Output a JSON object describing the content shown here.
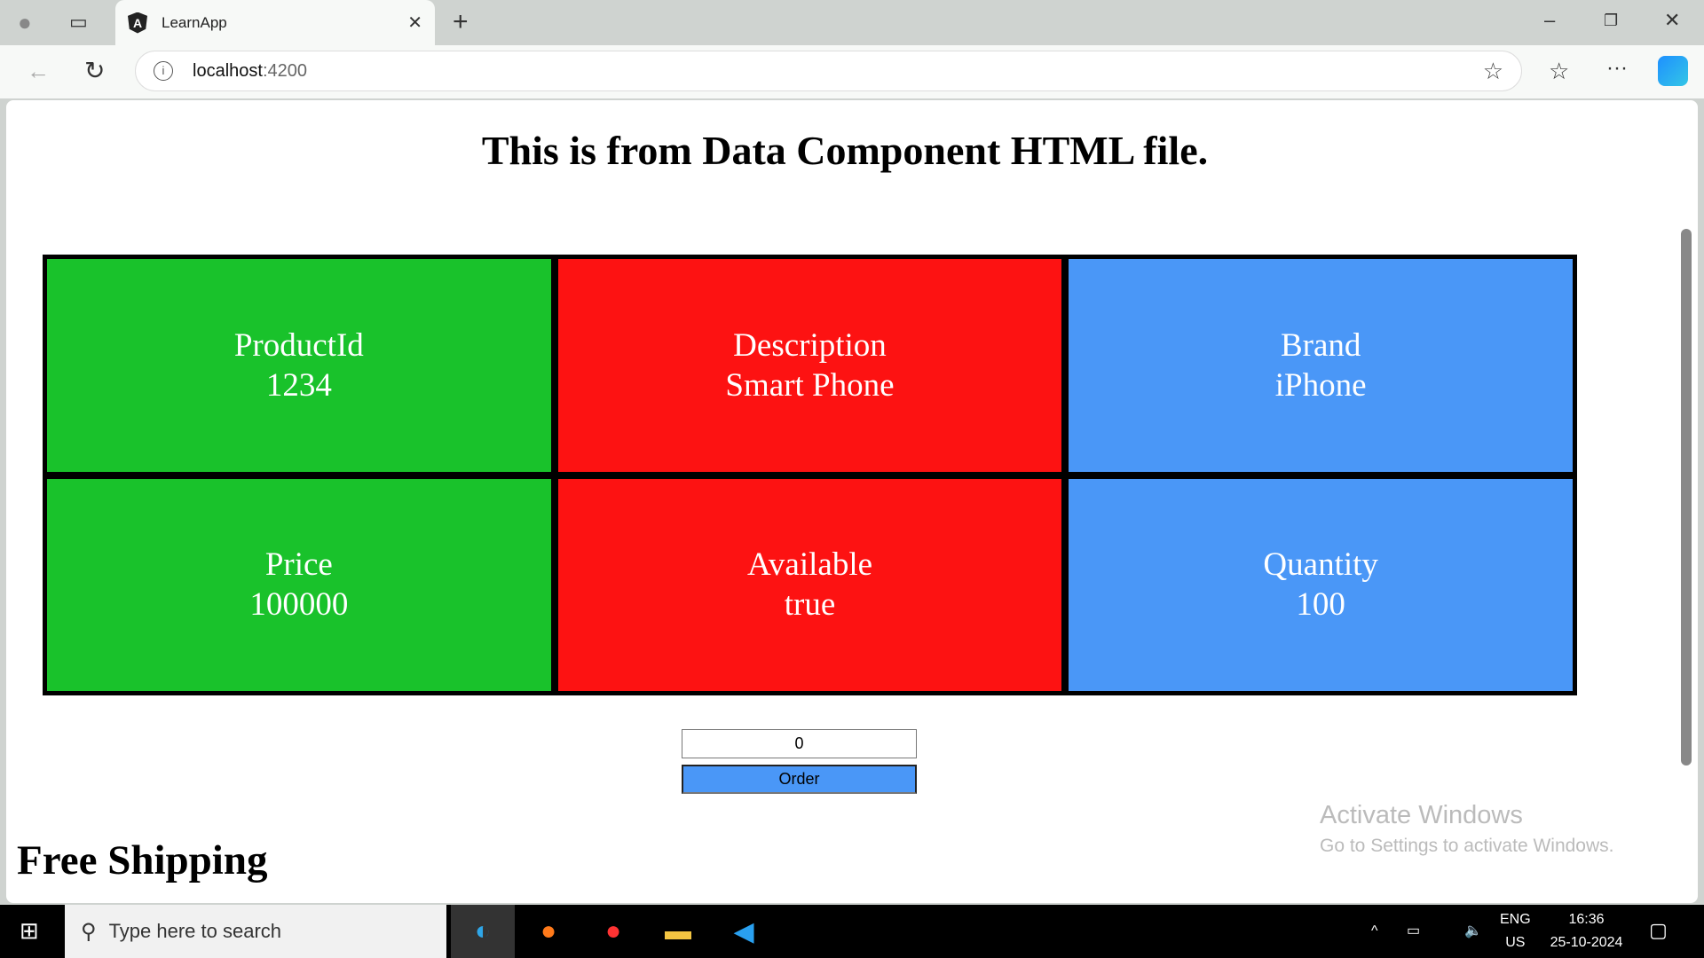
{
  "browser": {
    "tab_title": "LearnApp",
    "url_host": "localhost",
    "url_port": ":4200"
  },
  "page": {
    "heading": "This is from Data Component HTML file.",
    "cells": [
      {
        "label": "ProductId",
        "value": "1234",
        "color": "#19c22b"
      },
      {
        "label": "Description",
        "value": "Smart Phone",
        "color": "#fd1212"
      },
      {
        "label": "Brand",
        "value": "iPhone",
        "color": "#4a97f7"
      },
      {
        "label": "Price",
        "value": "100000",
        "color": "#19c22b"
      },
      {
        "label": "Available",
        "value": "true",
        "color": "#fd1212"
      },
      {
        "label": "Quantity",
        "value": "100",
        "color": "#4a97f7"
      }
    ],
    "quantity_input": "0",
    "order_button": "Order",
    "shipping": "Free Shipping"
  },
  "watermark": {
    "line1": "Activate Windows",
    "line2": "Go to Settings to activate Windows."
  },
  "taskbar": {
    "search_placeholder": "Type here to search",
    "lang": "ENG",
    "region": "US",
    "time": "16:36",
    "date": "25-10-2024"
  }
}
